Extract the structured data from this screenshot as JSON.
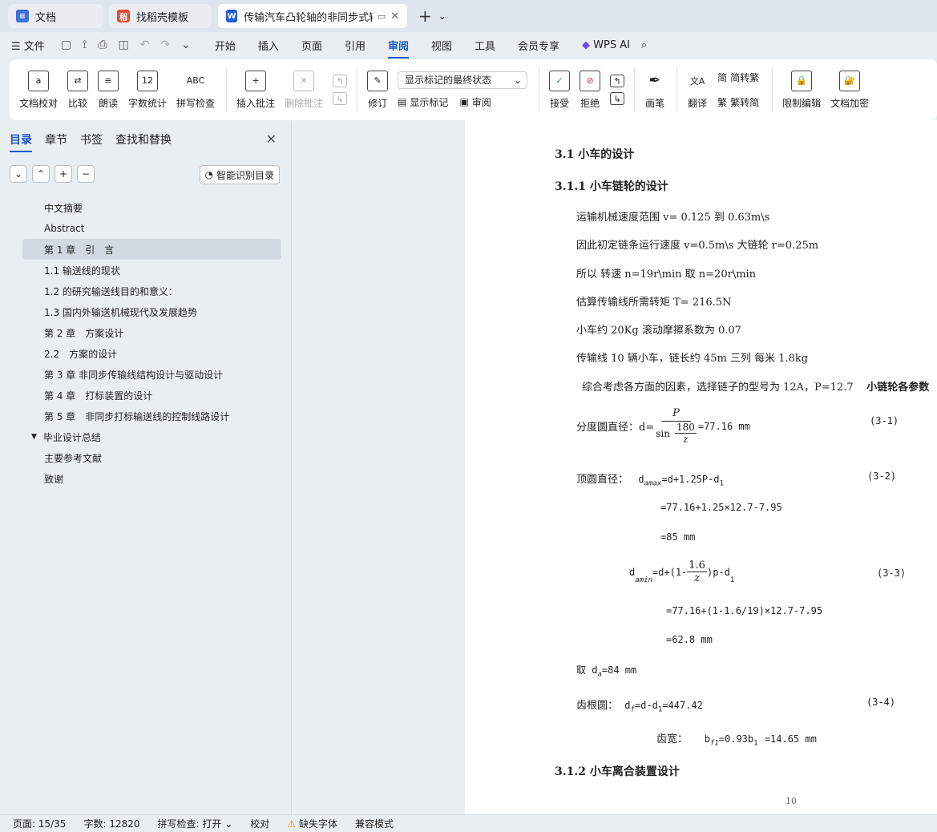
{
  "tabs": [
    {
      "label": "文档",
      "icon": "docs-icon",
      "color": "#3b6fd8"
    },
    {
      "label": "找稻壳模板",
      "icon": "docer-icon",
      "color": "#e04b3a"
    },
    {
      "label": "传输汽车凸轮轴的非同步式输送",
      "icon": "wps-writer-icon",
      "color": "#1f5fd6"
    }
  ],
  "menu": {
    "file": "文件",
    "items": [
      "开始",
      "插入",
      "页面",
      "引用",
      "审阅",
      "视图",
      "工具",
      "会员专享"
    ],
    "active": "审阅",
    "ai": "WPS AI"
  },
  "ribbon": {
    "check": "文档校对",
    "compare": "比较",
    "read": "朗读",
    "wordcount": "字数统计",
    "spell": "拼写检查",
    "insert_comment": "插入批注",
    "delete_comment": "删除批注",
    "revise": "修订",
    "markup_state": "显示标记的最终状态",
    "show_markup": "显示标记",
    "review": "审阅",
    "accept": "接受",
    "reject": "拒绝",
    "pen": "画笔",
    "translate": "翻译",
    "to_trad": "简转繁",
    "to_simp": "繁转简",
    "restrict": "限制编辑",
    "encrypt": "文档加密"
  },
  "panel": {
    "tabs": [
      "目录",
      "章节",
      "书签",
      "查找和替换"
    ],
    "smart_btn": "智能识别目录",
    "toc": [
      {
        "text": "中文摘要",
        "level": 1
      },
      {
        "text": "Abstract",
        "level": 1
      },
      {
        "text": "第 1 章　引　言",
        "level": 1,
        "selected": true
      },
      {
        "text": "1.1 输送线的现状",
        "level": 1
      },
      {
        "text": "1.2 的研究输送线目的和意义：",
        "level": 1
      },
      {
        "text": "1.3  国内外输送机械现代及发展趋势",
        "level": 1
      },
      {
        "text": "第 2 章　方案设计",
        "level": 1
      },
      {
        "text": "2.2　方案的设计",
        "level": 1
      },
      {
        "text": "第 3 章  非同步传输线结构设计与驱动设计",
        "level": 1
      },
      {
        "text": "第 4 章　打标装置的设计",
        "level": 1
      },
      {
        "text": "第 5 章　非同步打标输送线的控制线路设计",
        "level": 1
      },
      {
        "text": "毕业设计总结",
        "level": 0
      },
      {
        "text": "主要参考文献",
        "level": 1
      },
      {
        "text": "致谢",
        "level": 1
      }
    ]
  },
  "doc": {
    "h31": "3.1 小车的设计",
    "h311": "3.1.1 小车链轮的设计",
    "p1": "运输机械速度范围 v= 0.125 到 0.63m\\s",
    "p2": "因此初定链条运行速度 v=0.5m\\s    大链轮 r=0.25m",
    "p3": "所以 转速 n=19r\\min      取 n=20r\\min",
    "p4": "估算传输线所需转矩   T= 216.5N",
    "p5": "小车约 20Kg    滚动摩擦系数为 0.07",
    "p6": "传输线 10 辆小车，链长约 45m    三列 每米 1.8kg",
    "p7": "综合考虑各方面的因素，选择链子的型号为 12A，P=12.7",
    "p7b": "小链轮各参数",
    "e1_label": "分度圆直径：d=",
    "e1_num": "P",
    "e1_den_a": "sin",
    "e1_den_b": "180",
    "e1_den_c": "z",
    "e1_res": "=77.16 mm",
    "e1_no": "(3-1)",
    "e2_label": "顶圆直径：",
    "e2_body": "d",
    "e2_sub": "amax",
    "e2_rest": "=d+1.25P-d",
    "e2_sub2": "1",
    "e2_no": "(3-2)",
    "e2_l2": "=77.16+1.25×12.7-7.95",
    "e2_l3": "=85 mm",
    "e3_body": "d",
    "e3_sub": "amin",
    "e3_a": "=d+(1-",
    "e3_num": "1.6",
    "e3_den": "z",
    "e3_b": ")p-d",
    "e3_sub2": "1",
    "e3_no": "(3-3)",
    "e3_l2": "=77.16+(1-1.6/19)×12.7-7.95",
    "e3_l3": "=62.8 mm",
    "e4": "取 d",
    "e4_sub": "a",
    "e4_rest": "=84 mm",
    "e5_label": "齿根圆：",
    "e5_body": "d",
    "e5_sub": "f",
    "e5_rest": "=d-d",
    "e5_sub2": "1",
    "e5_res": "=447.42",
    "e5_no": "(3-4)",
    "e6_label": "齿宽：",
    "e6_body": "b",
    "e6_sub": "f1",
    "e6_rest": "=0.93b",
    "e6_sub2": "1",
    "e6_res": "=14.65 mm",
    "h312": "3.1.2 小车离合装置设计",
    "page_no": "10"
  },
  "status": {
    "page": "页面: 15/35",
    "words": "字数: 12820",
    "spell": "拼写检查: 打开",
    "proof": "校对",
    "font_missing": "缺失字体",
    "compat": "兼容模式"
  }
}
